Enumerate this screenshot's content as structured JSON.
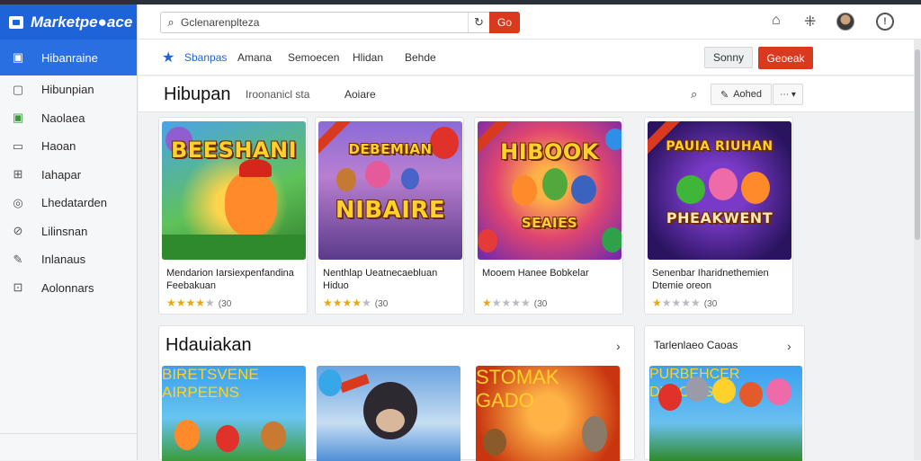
{
  "app": {
    "logo_text": "Marketpe●ace"
  },
  "topbar": {
    "search_query": "Gclenarenplteza",
    "go_label": "Go",
    "icons": [
      "home-icon",
      "grid-icon",
      "avatar",
      "info-icon"
    ]
  },
  "sidebar": {
    "active": {
      "label": "Hibanraine",
      "icon": "store-icon"
    },
    "items": [
      {
        "label": "Hibunpian",
        "icon": "window-icon"
      },
      {
        "label": "Naolaea",
        "icon": "image-icon"
      },
      {
        "label": "Haoan",
        "icon": "monitor-icon"
      },
      {
        "label": "Iahapar",
        "icon": "puzzle-icon"
      },
      {
        "label": "Lhedatarden",
        "icon": "target-icon"
      },
      {
        "label": "Lilinsnan",
        "icon": "compass-icon"
      },
      {
        "label": "Inlanaus",
        "icon": "wrench-icon"
      },
      {
        "label": "Aolonnars",
        "icon": "download-icon"
      }
    ]
  },
  "nav": {
    "links": [
      "Sbanpas",
      "Amana",
      "Semoecen",
      "Hlidan",
      "Behde"
    ],
    "button_secondary": "Sonny",
    "button_primary": "Geoeak"
  },
  "section": {
    "title": "Hibupan",
    "subtitle": "Iroonanicl sta",
    "subtitle2": "Aoiare",
    "action_label": "Aohed"
  },
  "cards": [
    {
      "title": "BEESHANI",
      "desc": "Mendarion Iarsiexpenfandina Feebakuan",
      "rating": 4,
      "count": "(30",
      "color": "#3aa048"
    },
    {
      "title": "NIBAIRE",
      "title_top": "DEBEMIAN",
      "desc": "Nenthlap Ueatnecaebluan Hiduo",
      "rating": 4,
      "count": "(30",
      "color": "#7b5cc2"
    },
    {
      "title": "HIBOOK",
      "title_bottom": "SEAIES",
      "desc": "Mooem Hanee Bobkelar",
      "rating": 1,
      "count": "(30",
      "color": "#b5238c"
    },
    {
      "title": "PHEAKWENT",
      "title_top": "PAUIA RIUHAN",
      "desc": "Senenbar Iharidnethemien Dtemie oreon",
      "rating": 1,
      "count": "(30",
      "color": "#3b1f7a"
    }
  ],
  "row2": {
    "title": "Hdauiakan",
    "side_title": "Tarlenlaeo Caoas",
    "cards": [
      {
        "title": "BIRETSVENE AIRPEENS",
        "color": "#2f8fe0"
      },
      {
        "title": "",
        "color": "#4f8fd6"
      },
      {
        "title": "STOMAK GADO",
        "color": "#c8350f"
      },
      {
        "title": "PURBEHCER DKAOAIS",
        "color": "#2f8fe0"
      }
    ]
  }
}
